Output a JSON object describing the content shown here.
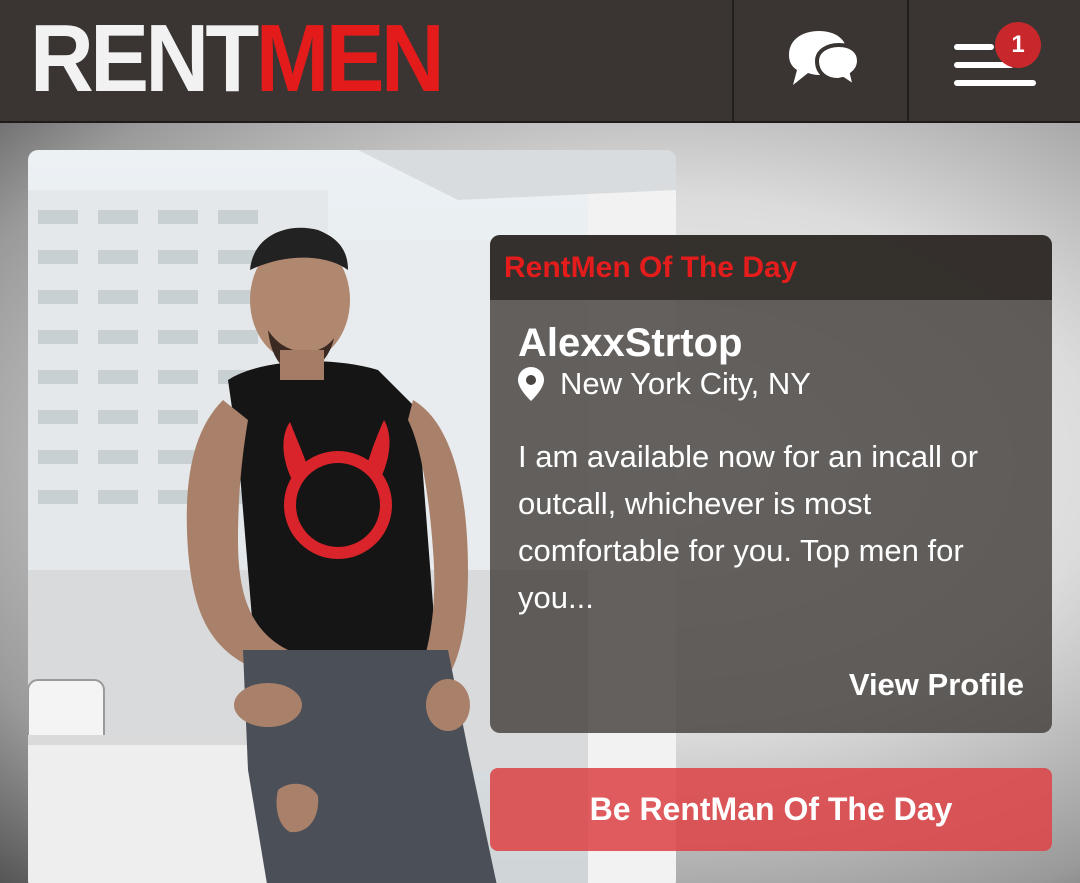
{
  "header": {
    "logo_part1": "RENT",
    "logo_part2": "MEN",
    "chat_icon": "chat-bubbles-icon",
    "menu_icon": "hamburger-menu-icon",
    "notification_count": "1"
  },
  "featured": {
    "section_title": "RentMen Of The Day",
    "name": "AlexxStrtop",
    "location": "New York City, NY",
    "location_icon": "map-pin-icon",
    "description": "I am available now for an incall or outcall, whichever is most comfortable for you. Top men for you...",
    "view_profile_label": "View Profile"
  },
  "cta": {
    "label": "Be RentMan Of The Day"
  },
  "colors": {
    "brand_red": "#e41b1b",
    "header_bg": "#3a3532",
    "badge_red": "#c8282b"
  }
}
